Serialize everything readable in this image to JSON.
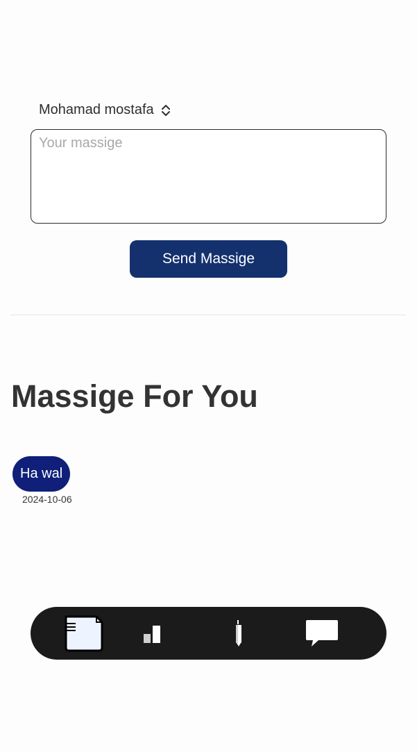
{
  "compose": {
    "recipient": "Mohamad mostafa",
    "message_placeholder": "Your massige",
    "message_value": "",
    "send_label": "Send Massige"
  },
  "inbox": {
    "title": "Massige For You",
    "messages": [
      {
        "text": "Ha wal",
        "date": "2024-10-06"
      }
    ]
  },
  "bottom_nav": {
    "items": [
      {
        "icon": "notes-icon",
        "active": true
      },
      {
        "icon": "bar-chart-icon",
        "active": false
      },
      {
        "icon": "pen-icon",
        "active": false
      },
      {
        "icon": "chat-bubble-icon",
        "active": false
      }
    ]
  },
  "colors": {
    "primary_button": "#14316e",
    "message_bubble": "#0f1f7a",
    "nav_background": "#1b1b1b",
    "active_icon_fill": "#eef4ff",
    "text": "#333333"
  }
}
